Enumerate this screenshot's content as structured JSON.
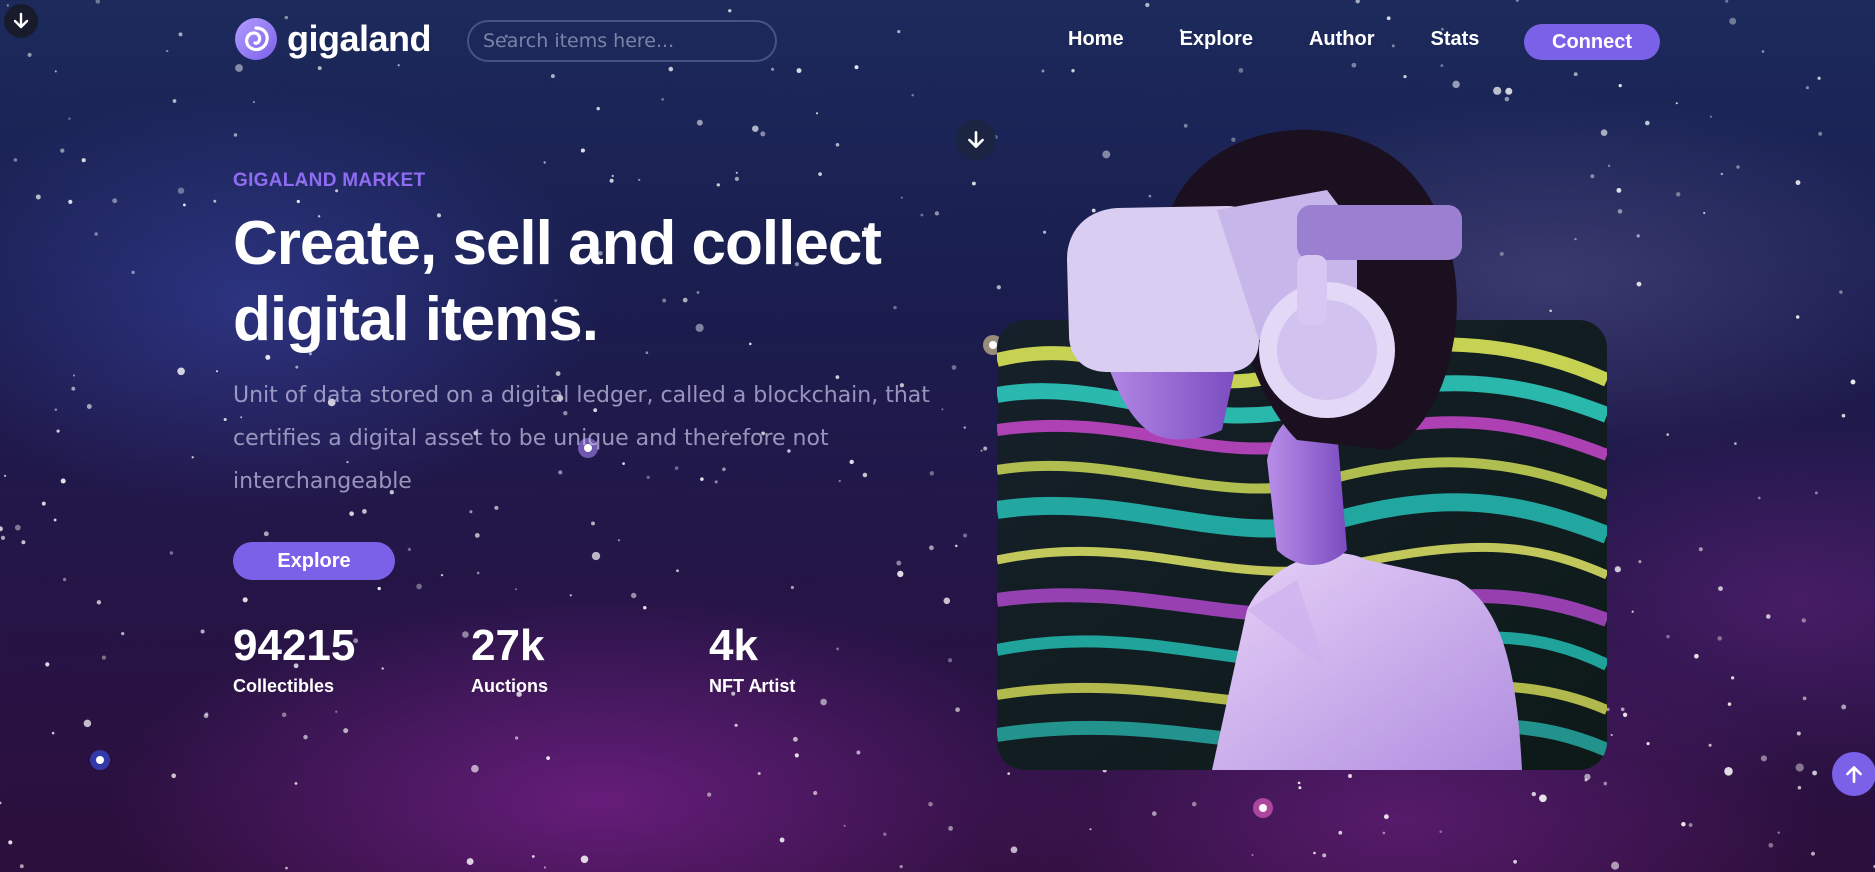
{
  "brand": {
    "name": "gigaland",
    "logo_icon": "swirl-logo-icon",
    "accent": "#7b61e8"
  },
  "search": {
    "placeholder": "Search items here..."
  },
  "nav": {
    "items": [
      "Home",
      "Explore",
      "Author",
      "Stats"
    ],
    "connect_label": "Connect"
  },
  "hero": {
    "eyebrow": "GIGALAND MARKET",
    "title": "Create, sell and collect digital items.",
    "description": "Unit of data stored on a digital ledger, called a blockchain, that certifies a digital asset to be unique and therefore not interchangeable",
    "cta_label": "Explore"
  },
  "stats": [
    {
      "value": "94215",
      "label": "Collectibles"
    },
    {
      "value": "27k",
      "label": "Auctions"
    },
    {
      "value": "4k",
      "label": "NFT Artist"
    }
  ],
  "icons": {
    "scroll_down": "arrow-down-icon",
    "scroll_up": "arrow-up-icon"
  },
  "colors": {
    "accent": "#7b61e8",
    "eyebrow": "#8f6cf2",
    "bg_top": "#1c2a5c",
    "bg_bottom": "#2c0f3c"
  }
}
